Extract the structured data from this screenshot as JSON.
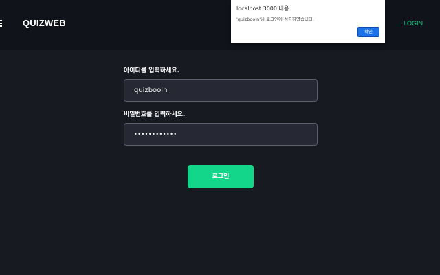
{
  "header": {
    "logo": "QUIZWEB",
    "login_link": "LOGIN"
  },
  "form": {
    "id_label": "아이디를 입력하세요.",
    "id_value": "quizbooin",
    "password_label": "비밀번호를 입력하세요.",
    "password_value": "••••••••••••",
    "submit_label": "로그인"
  },
  "dialog": {
    "title": "localhost:3000 내용:",
    "message": "'quizbooin'님 로그인이 성공하였습니다.",
    "ok_label": "확인"
  },
  "colors": {
    "background": "#181a22",
    "accent": "#13d68a",
    "dialog_button": "#1a73e8"
  },
  "icons": [
    "hamburger-menu-icon"
  ]
}
